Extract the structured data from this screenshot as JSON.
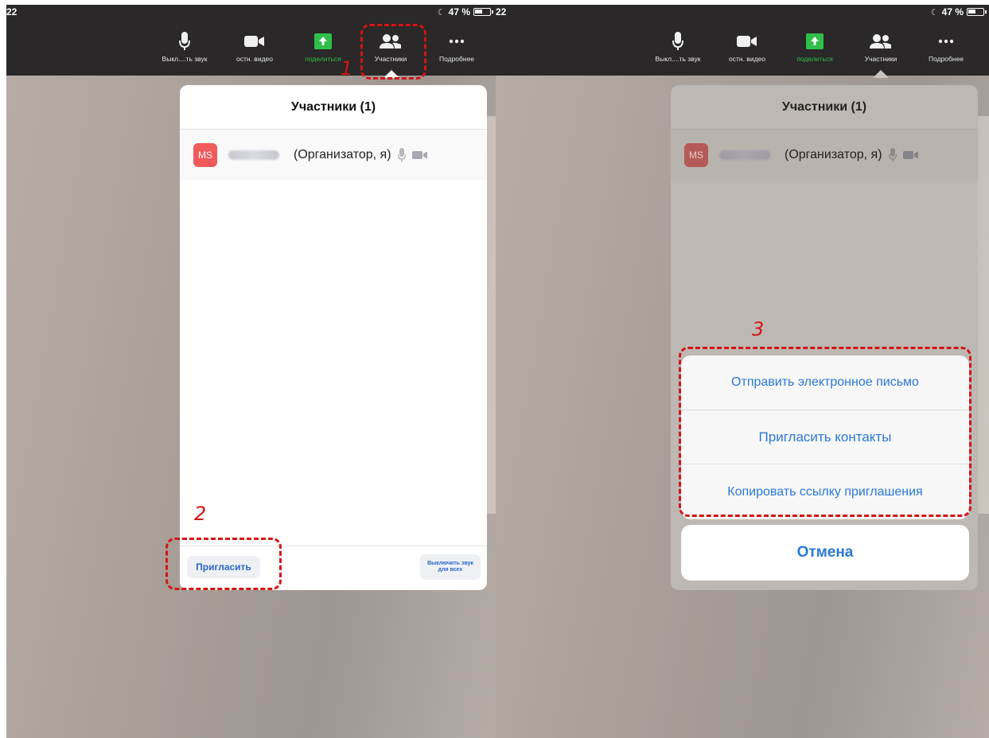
{
  "left_panel": {
    "status": {
      "time": "22",
      "battery": "47 %"
    },
    "toolbar": [
      {
        "label": "Выкл....ть звук",
        "icon": "mic-icon"
      },
      {
        "label": "остн. видео",
        "icon": "video-camera-icon"
      },
      {
        "label": "поделиться",
        "icon": "share-screen-icon"
      },
      {
        "label": "Участники",
        "icon": "participants-icon"
      },
      {
        "label": "Подробнее",
        "icon": "more-icon"
      }
    ],
    "sheet": {
      "title": "Участники (1)",
      "participant": {
        "initials": "MS",
        "role": "(Организатор, я)"
      },
      "invite_label": "Пригласить",
      "mute_all_label": "Выключить звук для всех"
    },
    "annotations": {
      "one": "1",
      "two": "2"
    }
  },
  "right_panel": {
    "status": {
      "time": "22",
      "battery": "47 %"
    },
    "toolbar": [
      {
        "label": "Выкл....ть звук",
        "icon": "mic-icon"
      },
      {
        "label": "остн. видео",
        "icon": "video-camera-icon"
      },
      {
        "label": "поделиться",
        "icon": "share-screen-icon"
      },
      {
        "label": "Участники",
        "icon": "participants-icon"
      },
      {
        "label": "Подробнее",
        "icon": "more-icon"
      }
    ],
    "sheet": {
      "title": "Участники (1)",
      "participant": {
        "initials": "MS",
        "role": "(Организатор, я)"
      }
    },
    "actions": [
      "Отправить электронное письмо",
      "Пригласить контакты",
      "Копировать ссылку приглашения"
    ],
    "cancel_label": "Отмена",
    "annotations": {
      "three": "3"
    }
  },
  "colors": {
    "accent_blue": "#2a78d8",
    "annotation_red": "#d41414",
    "avatar_red": "#f05a5a",
    "share_green": "#2fbf4a",
    "toolbar_dark": "#2a2828"
  }
}
